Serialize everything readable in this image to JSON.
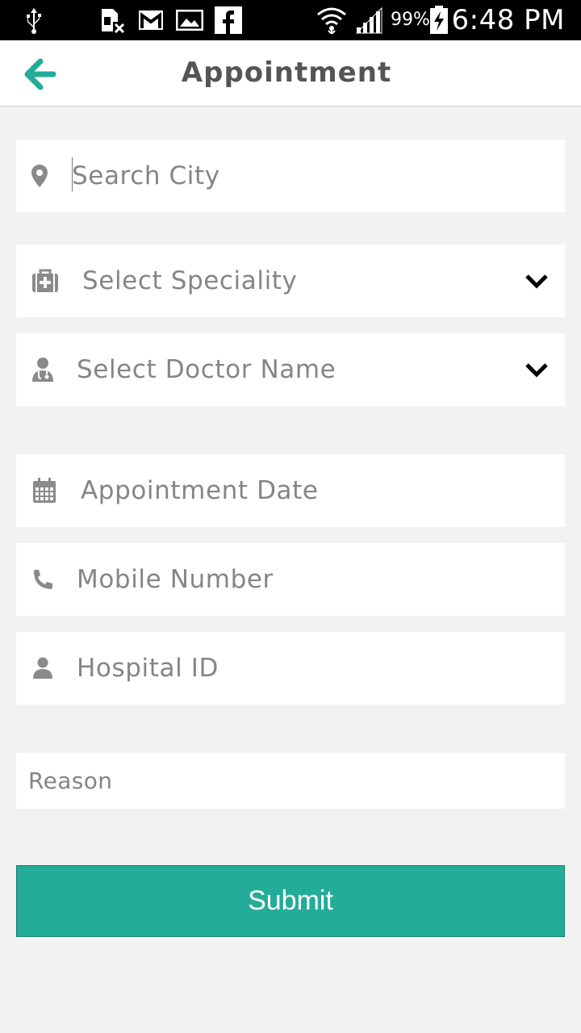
{
  "status_bar": {
    "icons": [
      "usb-icon",
      "sim-missing-icon",
      "gmail-icon",
      "gallery-icon",
      "facebook-icon",
      "wifi-icon",
      "signal-icon",
      "battery-charging-icon"
    ],
    "battery_percent": "99%",
    "time": "6:48 PM"
  },
  "header": {
    "title": "Appointment",
    "back_icon": "arrow-left-icon",
    "accent_color": "#23ac98"
  },
  "form": {
    "search_city": {
      "placeholder": "Search City",
      "icon": "map-pin-icon"
    },
    "speciality": {
      "placeholder": "Select Speciality",
      "icon": "medical-kit-icon",
      "dropdown_icon": "chevron-down-icon"
    },
    "doctor": {
      "placeholder": "Select Doctor Name",
      "icon": "doctor-icon",
      "dropdown_icon": "chevron-down-icon"
    },
    "appointment_date": {
      "placeholder": "Appointment Date",
      "icon": "calendar-icon"
    },
    "mobile": {
      "placeholder": "Mobile Number",
      "icon": "phone-icon"
    },
    "hospital_id": {
      "placeholder": "Hospital ID",
      "icon": "user-icon"
    },
    "reason": {
      "placeholder": "Reason"
    },
    "submit_label": "Submit"
  },
  "colors": {
    "background": "#f2f2f2",
    "field_background": "#ffffff",
    "placeholder_text": "#858585",
    "icon_gray": "#8a8a8a",
    "submit_background": "#23ac98"
  }
}
